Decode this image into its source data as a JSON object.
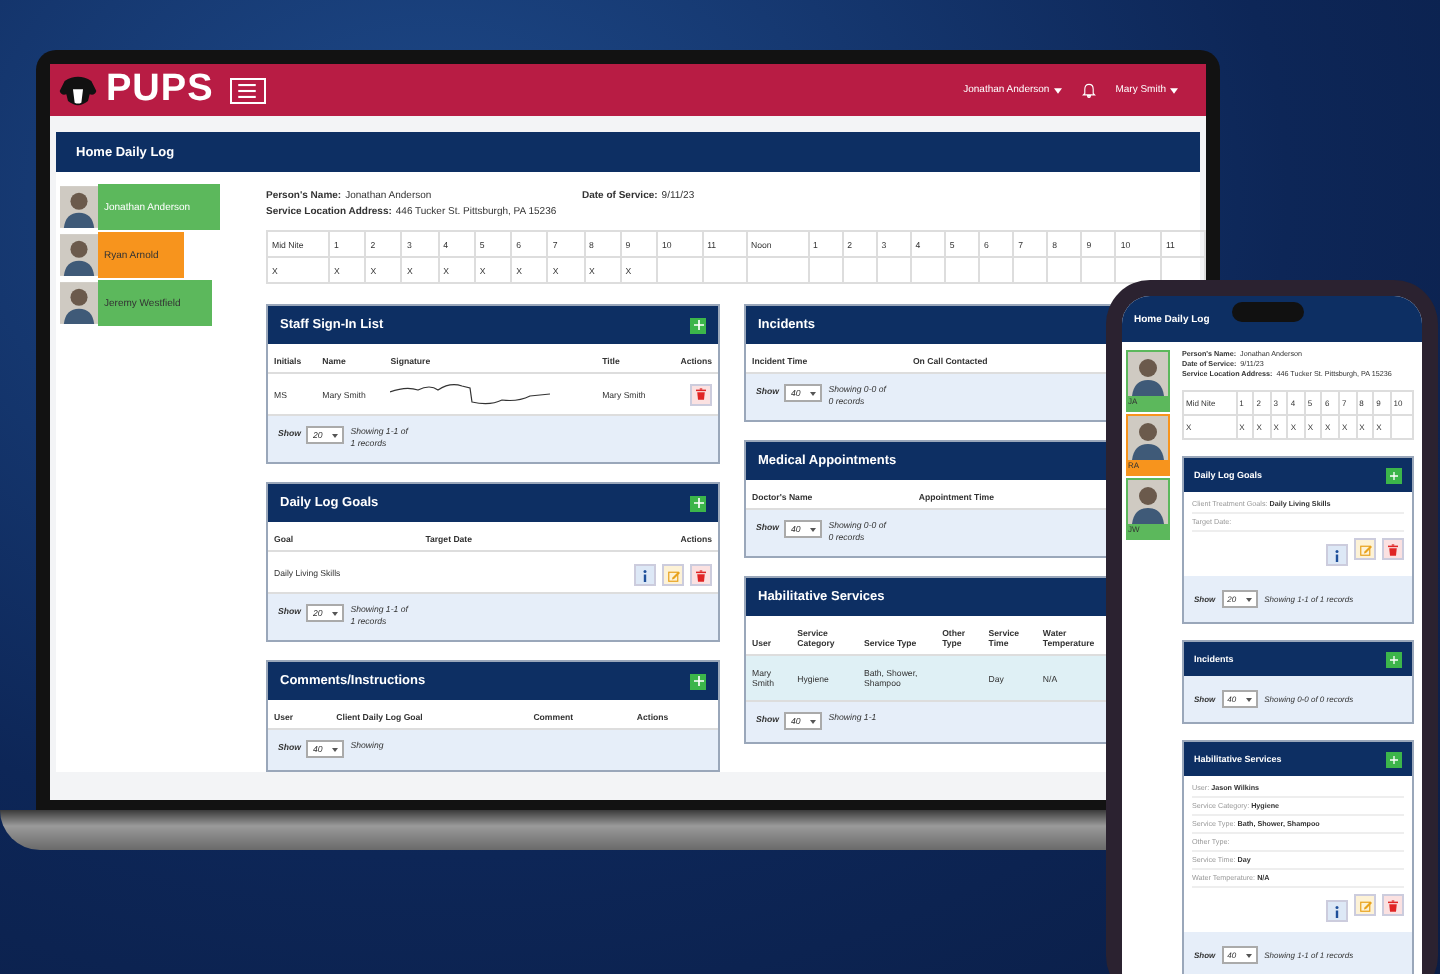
{
  "laptop": {
    "header": {
      "logo": "PUPS",
      "client_menu": "Jonathan Anderson",
      "user_menu": "Mary Smith"
    },
    "page_title": "Home Daily Log",
    "people": [
      {
        "name": "Jonathan Anderson",
        "color": "#5cb85c"
      },
      {
        "name": "Ryan Arnold",
        "color": "#f7941d"
      },
      {
        "name": "Jeremy Westfield",
        "color": "#5cb85c"
      }
    ],
    "info": [
      {
        "label": "Person's Name:",
        "value": "Jonathan Anderson"
      },
      {
        "label": "Date of Service:",
        "value": "9/11/23"
      },
      {
        "label": "Service Location Address:",
        "value": "446 Tucker St. Pittsburgh, PA 15236"
      }
    ],
    "hours": [
      {
        "label": "Mid Nite",
        "mark": "X"
      },
      {
        "label": "1",
        "mark": "X"
      },
      {
        "label": "2",
        "mark": "X"
      },
      {
        "label": "3",
        "mark": "X"
      },
      {
        "label": "4",
        "mark": "X"
      },
      {
        "label": "5",
        "mark": "X"
      },
      {
        "label": "6",
        "mark": "X"
      },
      {
        "label": "7",
        "mark": "X"
      },
      {
        "label": "8",
        "mark": "X"
      },
      {
        "label": "9",
        "mark": "X"
      },
      {
        "label": "10"
      },
      {
        "label": "11"
      },
      {
        "label": "Noon"
      },
      {
        "label": "1"
      },
      {
        "label": "2"
      },
      {
        "label": "3"
      },
      {
        "label": "4"
      },
      {
        "label": "5"
      },
      {
        "label": "6"
      },
      {
        "label": "7"
      },
      {
        "label": "8"
      },
      {
        "label": "9"
      },
      {
        "label": "10"
      },
      {
        "label": "11"
      }
    ],
    "cards_left": [
      {
        "title": "Staff Sign-In List",
        "add_button": true,
        "columns": [
          "Initials",
          "Name",
          "Signature",
          "Title",
          "Actions"
        ],
        "rows": [
          {
            "highlighted": false,
            "cells": [
              {
                "kind": "text",
                "text": "MS"
              },
              {
                "kind": "text",
                "text": "Mary Smith"
              },
              {
                "kind": "signature"
              },
              {
                "kind": "text",
                "text": "Mary Smith"
              }
            ],
            "actions": [
              {
                "kind": "delete"
              }
            ]
          }
        ],
        "footer": {
          "show_label": "Show",
          "page_size": "20",
          "showing": "Showing 1-1 of 1 records"
        }
      },
      {
        "title": "Daily Log Goals",
        "add_button": true,
        "columns": [
          "Goal",
          "Target Date",
          "Actions"
        ],
        "rows": [
          {
            "highlighted": false,
            "cells": [
              {
                "kind": "text",
                "text": "Daily Living Skills"
              },
              {
                "kind": "text"
              }
            ],
            "actions": [
              {
                "kind": "info"
              },
              {
                "kind": "edit"
              },
              {
                "kind": "delete"
              }
            ]
          }
        ],
        "footer": {
          "show_label": "Show",
          "page_size": "20",
          "showing": "Showing 1-1 of 1 records"
        }
      },
      {
        "title": "Comments/Instructions",
        "add_button": true,
        "columns": [
          "User",
          "Client Daily Log Goal",
          "Comment",
          "Actions"
        ],
        "footer": {
          "show_label": "Show",
          "page_size": "40",
          "showing": "Showing"
        }
      }
    ],
    "cards_right": [
      {
        "title": "Incidents",
        "add_button": false,
        "columns": [
          "Incident Time",
          "On Call Contacted"
        ],
        "footer": {
          "show_label": "Show",
          "page_size": "40",
          "showing": "Showing 0-0 of 0 records"
        }
      },
      {
        "title": "Medical Appointments",
        "add_button": false,
        "columns": [
          "Doctor's Name",
          "Appointment Time"
        ],
        "footer": {
          "show_label": "Show",
          "page_size": "40",
          "showing": "Showing 0-0 of 0 records"
        }
      },
      {
        "title": "Habilitative Services",
        "add_button": false,
        "columns": [
          "User",
          "Service Category",
          "Service Type",
          "Other Type",
          "Service Time",
          "Water Temperature"
        ],
        "rows": [
          {
            "highlighted": true,
            "cells": [
              {
                "kind": "text",
                "text": "Mary Smith"
              },
              {
                "kind": "text",
                "text": "Hygiene"
              },
              {
                "kind": "text",
                "text": "Bath, Shower, Shampoo"
              },
              {
                "kind": "text"
              },
              {
                "kind": "text",
                "text": "Day"
              },
              {
                "kind": "text",
                "text": "N/A"
              }
            ]
          }
        ],
        "footer": {
          "show_label": "Show",
          "page_size": "40",
          "showing": "Showing 1-1"
        }
      }
    ]
  },
  "phone": {
    "page_title": "Home Daily Log",
    "people": [
      {
        "initials": "JA",
        "color": "#5cb85c"
      },
      {
        "initials": "RA",
        "color": "#f7941d"
      },
      {
        "initials": "JW",
        "color": "#5cb85c"
      }
    ],
    "info": [
      {
        "label": "Person's Name:",
        "value": "Jonathan Anderson"
      },
      {
        "label": "Date of Service:",
        "value": "9/11/23"
      },
      {
        "label": "Service Location Address:",
        "value": "446 Tucker St. Pittsburgh, PA 15236"
      }
    ],
    "hours": [
      {
        "label": "Mid Nite",
        "mark": "X"
      },
      {
        "label": "1",
        "mark": "X"
      },
      {
        "label": "2",
        "mark": "X"
      },
      {
        "label": "3",
        "mark": "X"
      },
      {
        "label": "4",
        "mark": "X"
      },
      {
        "label": "5",
        "mark": "X"
      },
      {
        "label": "6",
        "mark": "X"
      },
      {
        "label": "7",
        "mark": "X"
      },
      {
        "label": "8",
        "mark": "X"
      },
      {
        "label": "9",
        "mark": "X"
      },
      {
        "label": "10"
      }
    ],
    "cards": [
      {
        "title": "Daily Log Goals",
        "add_button": true,
        "fields": [
          {
            "label": "Client Treatment Goals:",
            "value": "Daily Living Skills"
          },
          {
            "label": "Target Date:"
          }
        ],
        "actions": [
          {
            "kind": "info"
          },
          {
            "kind": "edit"
          },
          {
            "kind": "delete"
          }
        ],
        "footer": {
          "show_label": "Show",
          "page_size": "20",
          "showing": "Showing 1-1 of 1 records"
        }
      },
      {
        "title": "Incidents",
        "add_button": true,
        "footer": {
          "show_label": "Show",
          "page_size": "40",
          "showing": "Showing 0-0 of 0 records"
        }
      },
      {
        "title": "Habilitative Services",
        "add_button": true,
        "fields": [
          {
            "label": "User:",
            "value": "Jason Wilkins"
          },
          {
            "label": "Service Category:",
            "value": "Hygiene"
          },
          {
            "label": "Service Type:",
            "value": "Bath, Shower, Shampoo"
          },
          {
            "label": "Other Type:"
          },
          {
            "label": "Service Time:",
            "value": "Day"
          },
          {
            "label": "Water Temperature:",
            "value": "N/A"
          }
        ],
        "actions": [
          {
            "kind": "info"
          },
          {
            "kind": "edit"
          },
          {
            "kind": "delete"
          }
        ],
        "footer": {
          "show_label": "Show",
          "page_size": "40",
          "showing": "Showing 1-1 of 1 records"
        }
      }
    ]
  }
}
